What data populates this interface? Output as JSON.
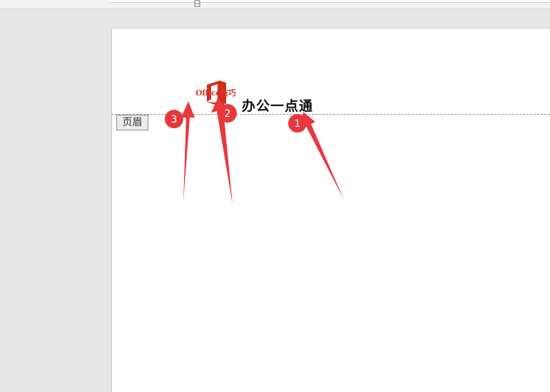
{
  "header_tag": {
    "label": "页眉"
  },
  "logo": {
    "text": "Office技巧",
    "icon": "office-logo-icon",
    "color": "#d33a2c"
  },
  "brand": {
    "text": "办公一点通"
  },
  "annotations": {
    "color": "#e8383d",
    "badges": [
      {
        "label": "1"
      },
      {
        "label": "2"
      },
      {
        "label": "3"
      }
    ]
  }
}
